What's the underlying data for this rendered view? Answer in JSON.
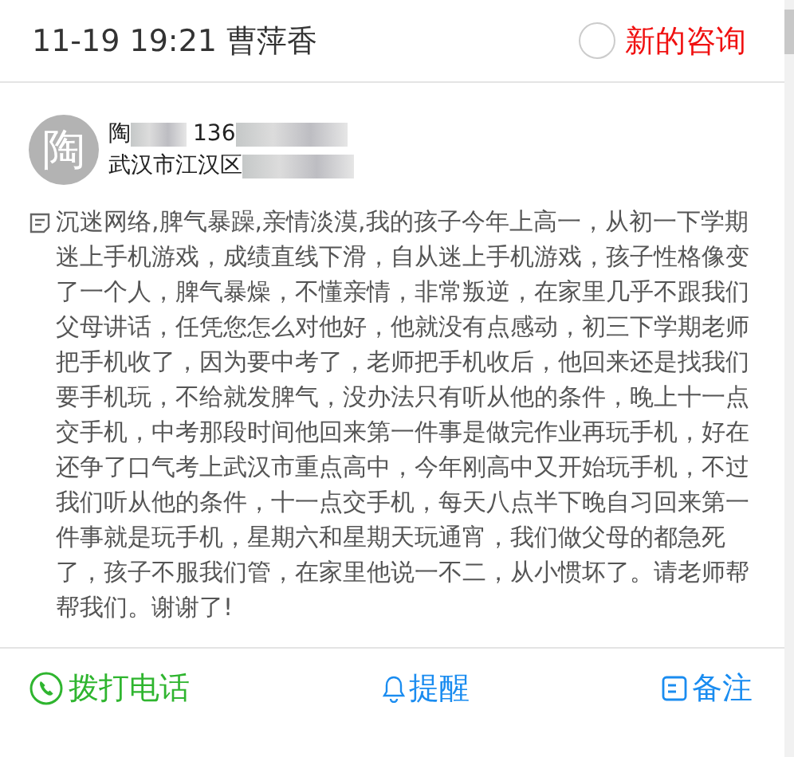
{
  "header": {
    "datetime": "11-19 19:21 曹萍香",
    "status_label": "新的咨询",
    "status_checked": false
  },
  "contact": {
    "avatar_text": "陶",
    "name": "陶",
    "phone": "136",
    "address": "武汉市江汉区"
  },
  "message": "沉迷网络,脾气暴躁,亲情淡漠,我的孩子今年上高一，从初一下学期迷上手机游戏，成绩直线下滑，自从迷上手机游戏，孩子性格像变了一个人，脾气暴燥，不懂亲情，非常叛逆，在家里几乎不跟我们父母讲话，任凭您怎么对他好，他就没有点感动，初三下学期老师把手机收了，因为要中考了，老师把手机收后，他回来还是找我们要手机玩，不给就发脾气，没办法只有听从他的条件，晚上十一点交手机，中考那段时间他回来第一件事是做完作业再玩手机，好在还争了口气考上武汉市重点高中，今年刚高中又开始玩手机，不过我们听从他的条件，十一点交手机，每天八点半下晚自习回来第一件事就是玩手机，星期六和星期天玩通宵，我们做父母的都急死了，孩子不服我们管，在家里他说一不二，从小惯坏了。请老师帮帮我们。谢谢了!",
  "actions": [
    {
      "kind": "call",
      "label": "拨打电话"
    },
    {
      "kind": "remind",
      "label": "提醒"
    },
    {
      "kind": "note",
      "label": "备注"
    }
  ]
}
